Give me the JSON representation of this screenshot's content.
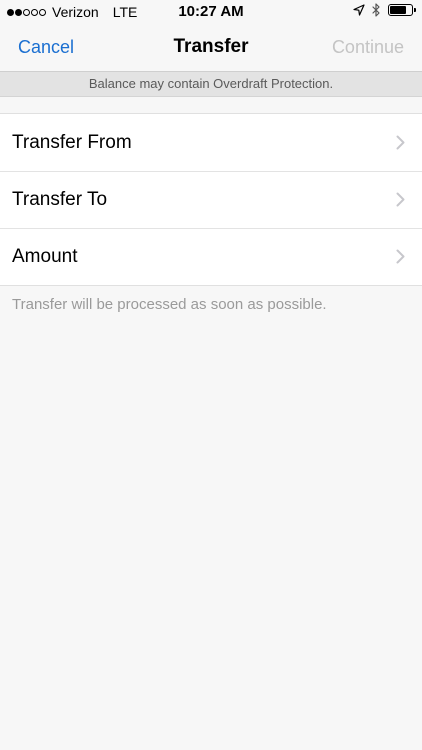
{
  "status_bar": {
    "carrier": "Verizon",
    "network": "LTE",
    "time": "10:27 AM",
    "signal_bars": 2,
    "signal_total": 5,
    "battery_level": 0.75,
    "icons": [
      "location-arrow-icon",
      "bluetooth-icon",
      "battery-icon"
    ]
  },
  "nav": {
    "cancel_label": "Cancel",
    "title": "Transfer",
    "continue_label": "Continue"
  },
  "banner": {
    "text": "Balance may contain Overdraft Protection."
  },
  "rows": [
    {
      "label": "Transfer From"
    },
    {
      "label": "Transfer To"
    },
    {
      "label": "Amount"
    }
  ],
  "footnote": "Transfer will be processed as soon as possible.",
  "colors": {
    "accent": "#1a6fd1",
    "disabled": "#c4c4c4",
    "background": "#f7f7f7",
    "banner_bg": "#e3e3e3"
  }
}
